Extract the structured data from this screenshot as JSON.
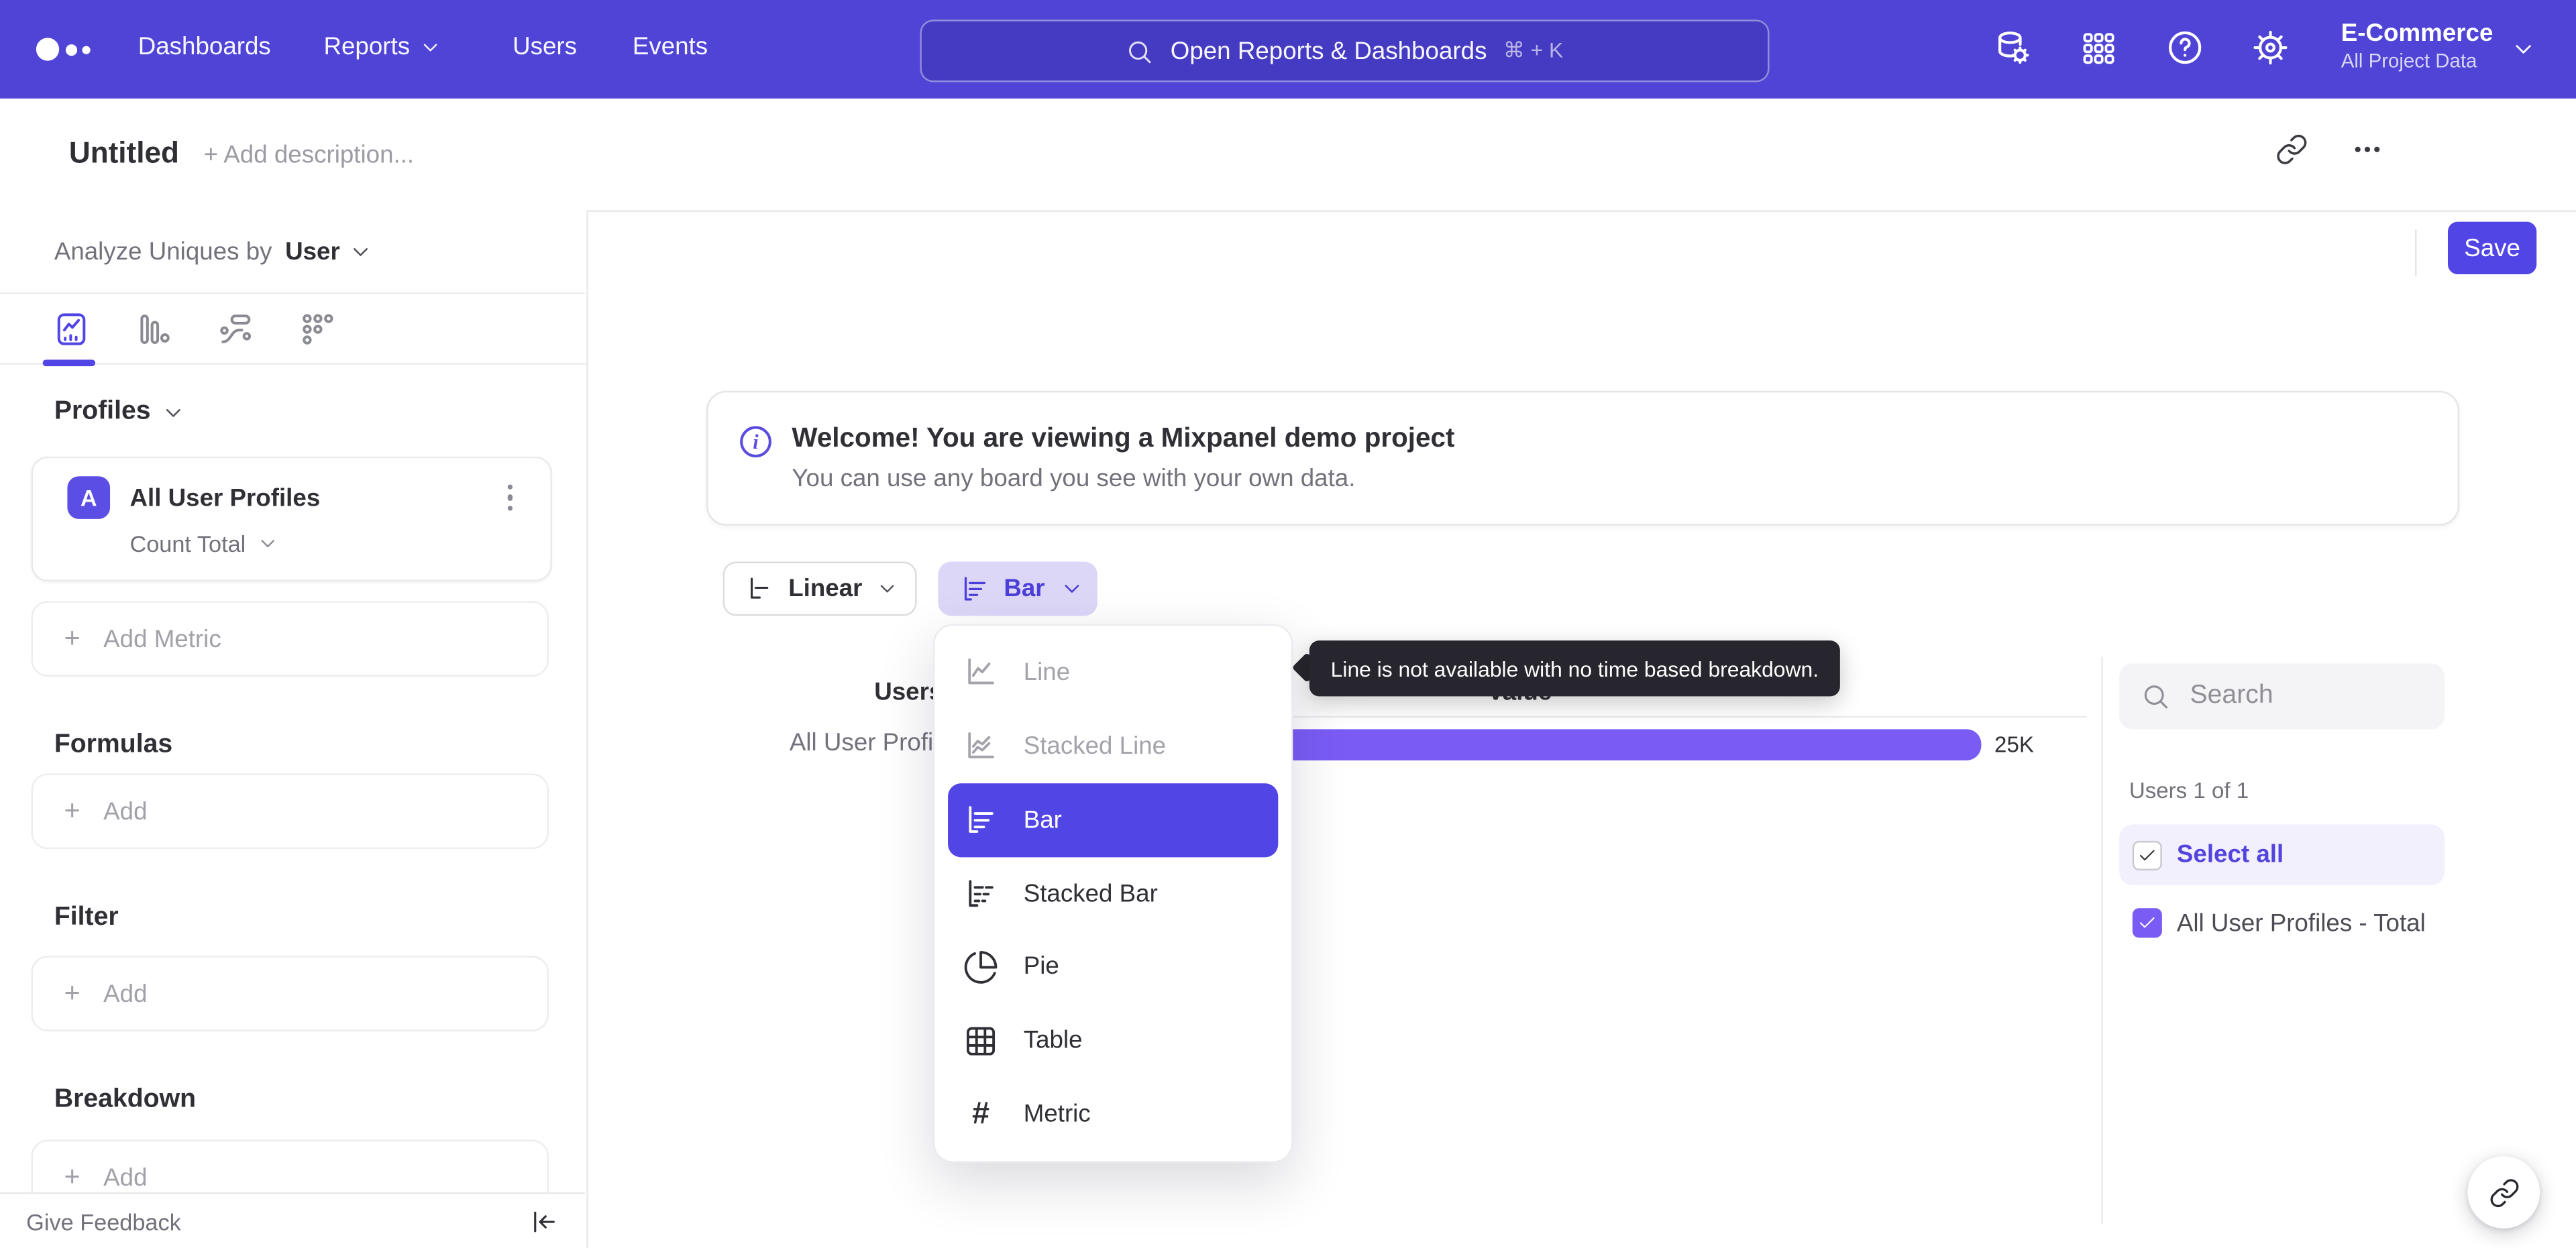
{
  "navbar": {
    "items": [
      {
        "label": "Dashboards"
      },
      {
        "label": "Reports"
      },
      {
        "label": "Users"
      },
      {
        "label": "Events"
      }
    ],
    "search": {
      "placeholder": "Open Reports & Dashboards",
      "shortcut": "⌘ + K"
    },
    "project": {
      "name": "E-Commerce",
      "scope": "All Project Data"
    }
  },
  "titlebar": {
    "title": "Untitled",
    "description_placeholder": "+ Add description...",
    "save": "Save"
  },
  "sidebar": {
    "analyze_prefix": "Analyze Uniques by",
    "analyze_value": "User",
    "profiles_heading": "Profiles",
    "metric": {
      "badge": "A",
      "name": "All User Profiles",
      "aggregation": "Count Total"
    },
    "plus": "+",
    "add_metric": "Add Metric",
    "formulas_heading": "Formulas",
    "filter_heading": "Filter",
    "breakdown_heading": "Breakdown",
    "add": "Add",
    "give_feedback": "Give Feedback"
  },
  "banner": {
    "title": "Welcome! You are viewing a Mixpanel demo project",
    "subtitle": "You can use any board you see with your own data."
  },
  "controls": {
    "scale": "Linear",
    "chart_type": "Bar"
  },
  "dropdown": {
    "items": [
      {
        "label": "Line",
        "state": "disabled"
      },
      {
        "label": "Stacked Line",
        "state": "disabled"
      },
      {
        "label": "Bar",
        "state": "selected"
      },
      {
        "label": "Stacked Bar",
        "state": "normal"
      },
      {
        "label": "Pie",
        "state": "normal"
      },
      {
        "label": "Table",
        "state": "normal"
      },
      {
        "label": "Metric",
        "state": "normal"
      }
    ],
    "metric_hash": "#"
  },
  "tooltip": {
    "text": "Line is not available with no time based breakdown."
  },
  "chart": {
    "col_users": "Users",
    "col_value": "Value",
    "row_label": "All User Profiles - Total",
    "value_label": "25K"
  },
  "chart_data": {
    "type": "bar",
    "orientation": "horizontal",
    "title": "",
    "columns": [
      "Users",
      "Value"
    ],
    "categories": [
      "All User Profiles - Total"
    ],
    "values": [
      25000
    ],
    "value_labels": [
      "25K"
    ],
    "bar_color": "#7a5cf5",
    "xlim": [
      0,
      26000
    ],
    "grid": false,
    "legend_position": "right"
  },
  "legend": {
    "search_placeholder": "Search",
    "count_label": "Users 1 of 1",
    "select_all": "Select all",
    "items": [
      {
        "label": "All User Profiles - Total",
        "checked": true
      }
    ]
  },
  "colors": {
    "navbar": "#4f44d6",
    "accent": "#5245e5",
    "bar": "#7a5cf5",
    "chip_bg": "#dcd7f7",
    "tooltip_bg": "#27262e"
  }
}
